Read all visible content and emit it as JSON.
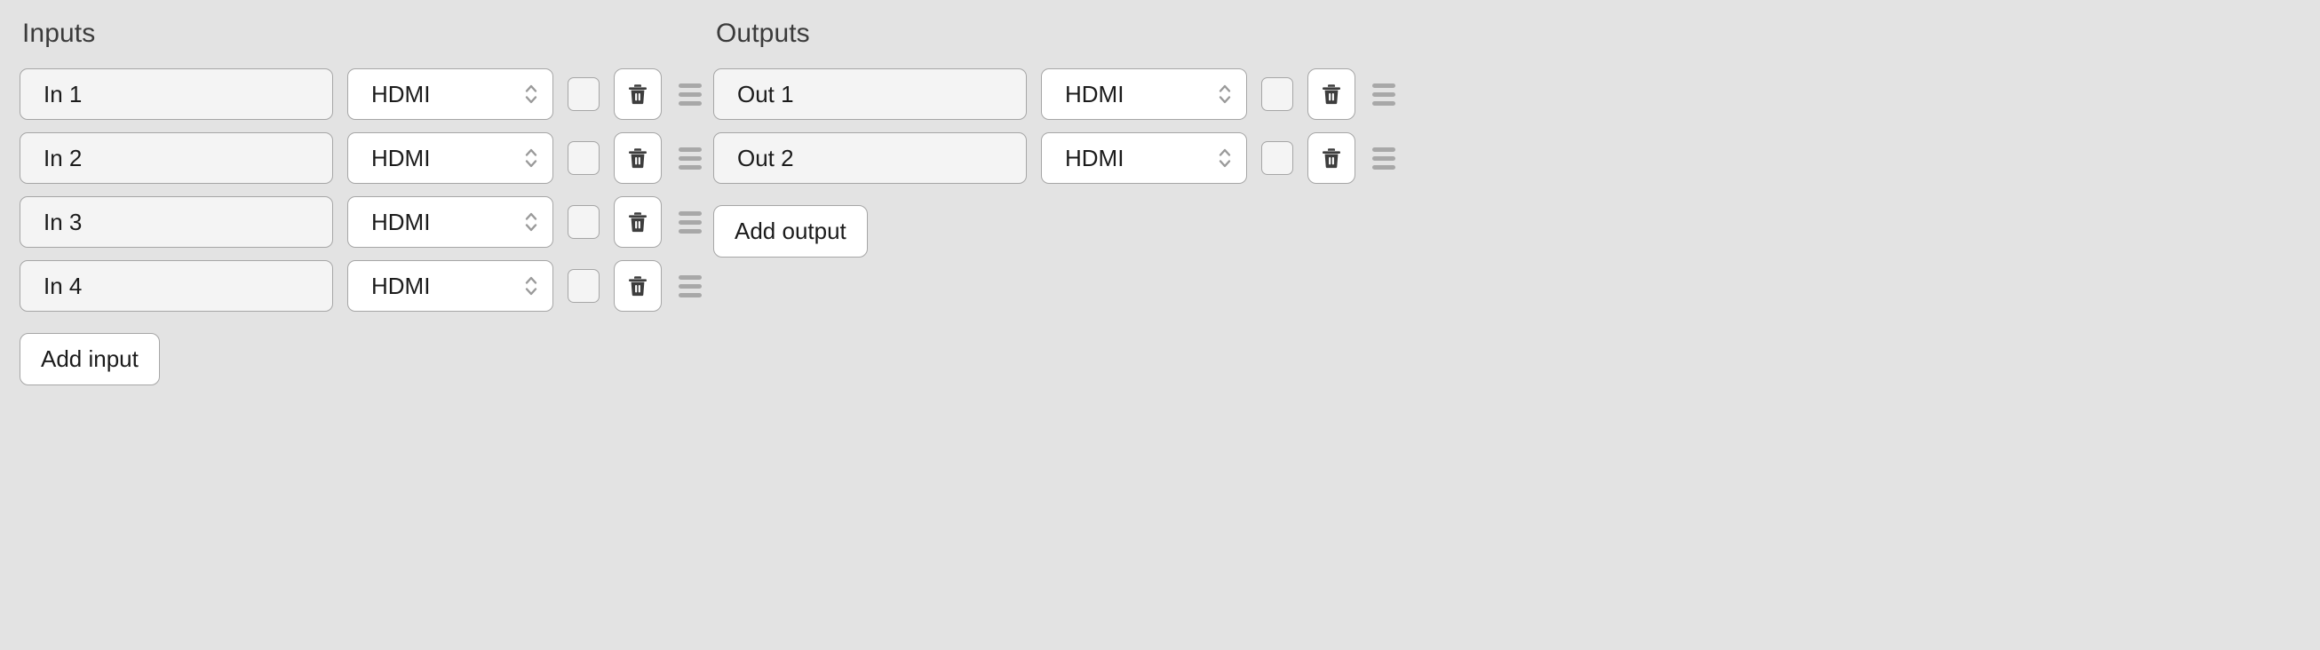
{
  "theme": {
    "page_background": "#e3e3e3",
    "field_background": "#f4f4f4",
    "control_background": "#ffffff",
    "border_color": "#a6a6a6",
    "text_color": "#1b1b1b",
    "heading_color": "#3b3b3b",
    "handle_color": "#a8a8a8",
    "icon_color": "#3d3d3d"
  },
  "inputs": {
    "title": "Inputs",
    "add_label": "Add input",
    "rows": [
      {
        "name": "In 1",
        "connector": "HDMI",
        "delete_icon": "trash-icon",
        "handle_icon": "drag-handle-icon",
        "stepper_icon": "chevron-up-down-icon"
      },
      {
        "name": "In 2",
        "connector": "HDMI",
        "delete_icon": "trash-icon",
        "handle_icon": "drag-handle-icon",
        "stepper_icon": "chevron-up-down-icon"
      },
      {
        "name": "In 3",
        "connector": "HDMI",
        "delete_icon": "trash-icon",
        "handle_icon": "drag-handle-icon",
        "stepper_icon": "chevron-up-down-icon"
      },
      {
        "name": "In 4",
        "connector": "HDMI",
        "delete_icon": "trash-icon",
        "handle_icon": "drag-handle-icon",
        "stepper_icon": "chevron-up-down-icon"
      }
    ]
  },
  "outputs": {
    "title": "Outputs",
    "add_label": "Add output",
    "rows": [
      {
        "name": "Out 1",
        "connector": "HDMI",
        "delete_icon": "trash-icon",
        "handle_icon": "drag-handle-icon",
        "stepper_icon": "chevron-up-down-icon"
      },
      {
        "name": "Out 2",
        "connector": "HDMI",
        "delete_icon": "trash-icon",
        "handle_icon": "drag-handle-icon",
        "stepper_icon": "chevron-up-down-icon"
      }
    ]
  }
}
